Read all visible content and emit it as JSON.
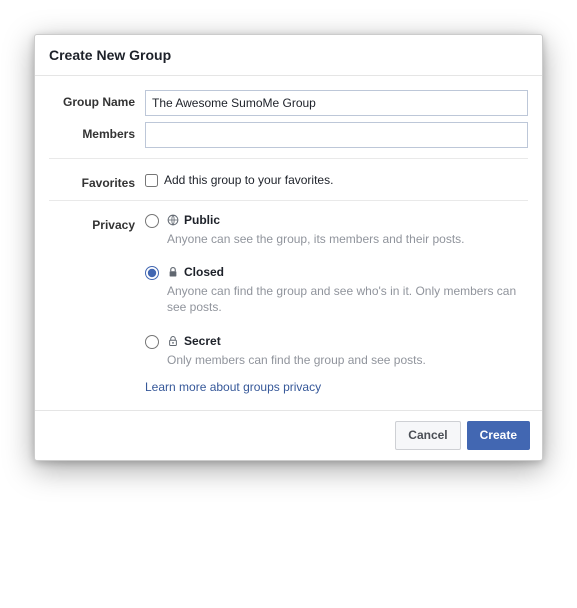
{
  "header": {
    "title": "Create New Group"
  },
  "form": {
    "groupName": {
      "label": "Group Name",
      "value": "The Awesome SumoMe Group"
    },
    "members": {
      "label": "Members",
      "value": ""
    },
    "favorites": {
      "label": "Favorites",
      "checkbox_label": "Add this group to your favorites.",
      "checked": false
    },
    "privacy": {
      "label": "Privacy",
      "selected": "closed",
      "options": {
        "public": {
          "title": "Public",
          "desc": "Anyone can see the group, its members and their posts."
        },
        "closed": {
          "title": "Closed",
          "desc": "Anyone can find the group and see who's in it. Only members can see posts."
        },
        "secret": {
          "title": "Secret",
          "desc": "Only members can find the group and see posts."
        }
      },
      "learn_more": "Learn more about groups privacy"
    }
  },
  "footer": {
    "cancel": "Cancel",
    "create": "Create"
  }
}
